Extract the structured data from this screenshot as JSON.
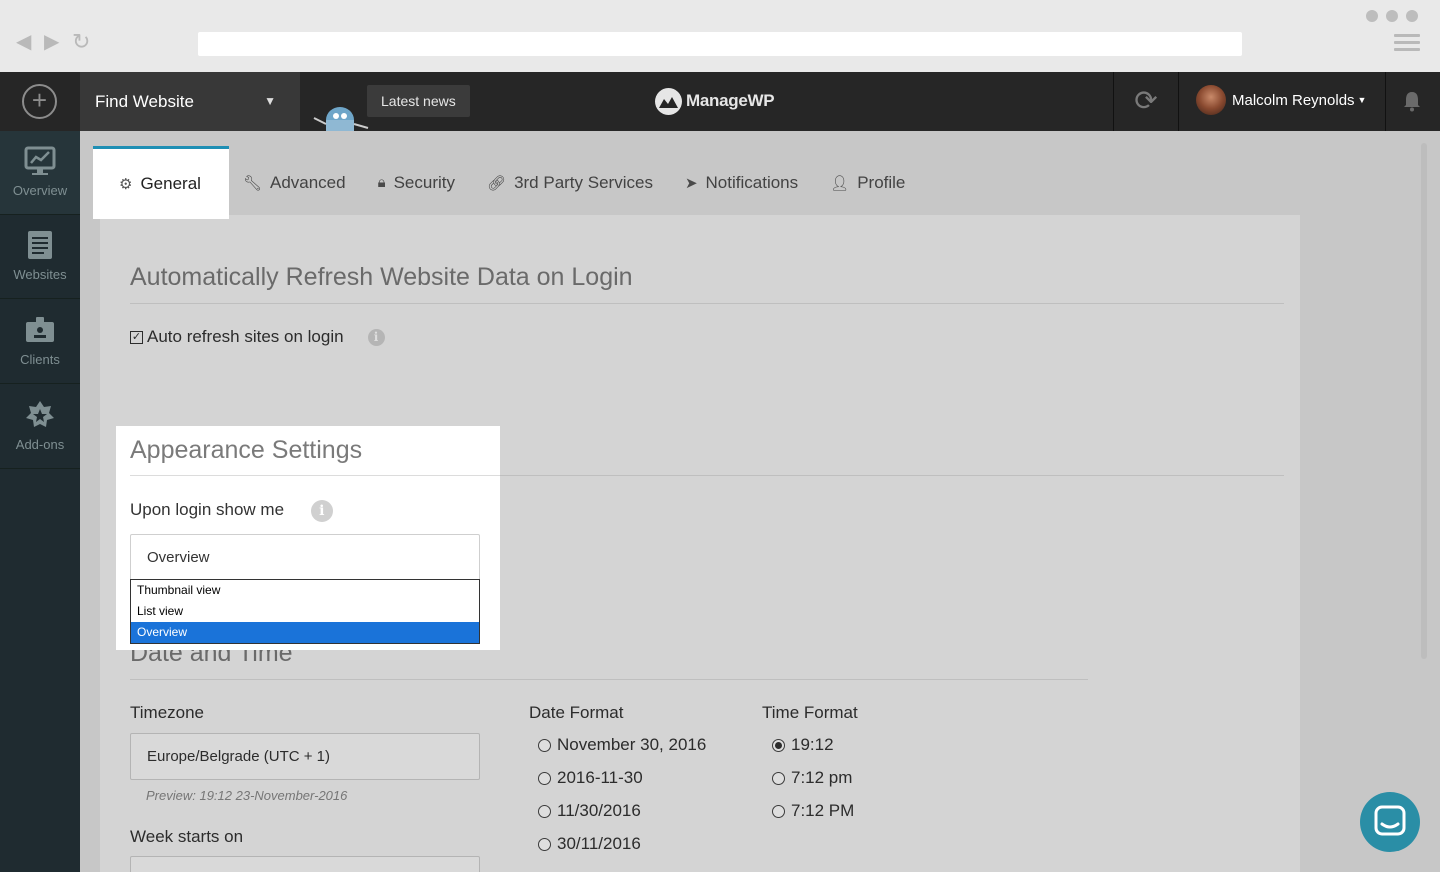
{
  "topbar": {
    "find_label": "Find Website",
    "news_label": "Latest news",
    "logo_text": "ManageWP",
    "user_name": "Malcolm Reynolds"
  },
  "sidebar": {
    "items": [
      {
        "label": "Overview",
        "icon": "overview-chart-icon"
      },
      {
        "label": "Websites",
        "icon": "websites-list-icon"
      },
      {
        "label": "Clients",
        "icon": "clients-id-icon"
      },
      {
        "label": "Add-ons",
        "icon": "addons-star-icon"
      }
    ]
  },
  "tabs": [
    {
      "label": "General",
      "icon": "gear-icon"
    },
    {
      "label": "Advanced",
      "icon": "wrench-icon"
    },
    {
      "label": "Security",
      "icon": "lock-icon"
    },
    {
      "label": "3rd Party Services",
      "icon": "link-icon"
    },
    {
      "label": "Notifications",
      "icon": "paper-plane-icon"
    },
    {
      "label": "Profile",
      "icon": "user-icon"
    }
  ],
  "refresh_section": {
    "title": "Automatically Refresh Website Data on Login",
    "checkbox_label": "Auto refresh sites on login",
    "checked": true
  },
  "appearance": {
    "title": "Appearance Settings",
    "login_label": "Upon login show me",
    "selected": "Overview",
    "options": [
      "Thumbnail view",
      "List view",
      "Overview"
    ]
  },
  "datetime": {
    "title": "Date and Time",
    "timezone_label": "Timezone",
    "timezone_value": "Europe/Belgrade (UTC + 1)",
    "preview": "Preview: 19:12 23-November-2016",
    "week_label": "Week starts on",
    "date_format_label": "Date Format",
    "date_formats": [
      "November 30, 2016",
      "2016-11-30",
      "11/30/2016",
      "30/11/2016"
    ],
    "time_format_label": "Time Format",
    "time_formats": [
      "19:12",
      "7:12 pm",
      "7:12 PM"
    ],
    "selected_time_format": "19:12"
  },
  "colors": {
    "accent": "#1f8fb4",
    "topbar": "#262626",
    "sidebar": "#1f2b30",
    "select_highlight": "#1a73d9",
    "chat_button": "#2a8ea6"
  }
}
